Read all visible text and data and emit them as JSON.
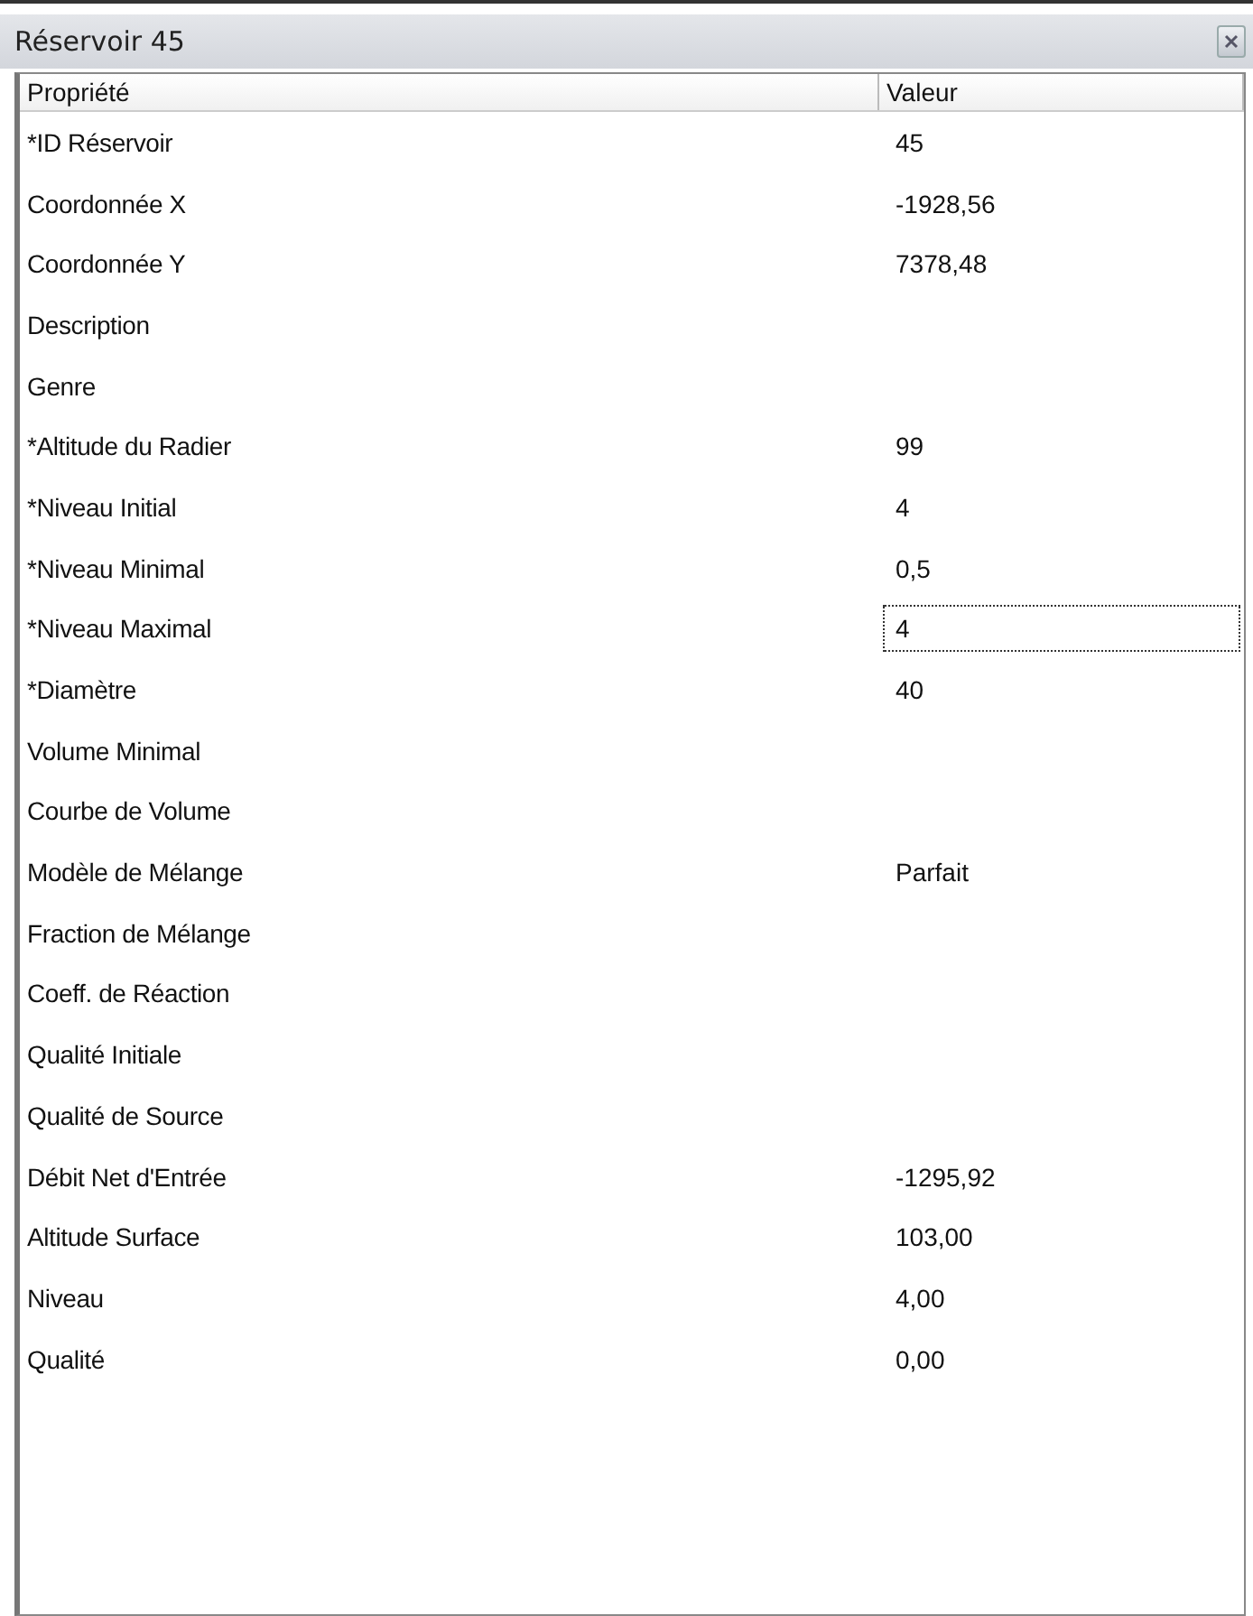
{
  "window": {
    "title": "Réservoir 45"
  },
  "table": {
    "columns": [
      "Propriété",
      "Valeur"
    ],
    "rows": [
      {
        "property": "*ID Réservoir",
        "value": "45",
        "focused": false
      },
      {
        "property": "Coordonnée X",
        "value": "-1928,56",
        "focused": false
      },
      {
        "property": "Coordonnée Y",
        "value": "7378,48",
        "focused": false
      },
      {
        "property": "Description",
        "focused": false
      },
      {
        "property": "Genre",
        "focused": false
      },
      {
        "property": "*Altitude du Radier",
        "value": "99",
        "focused": false
      },
      {
        "property": "*Niveau Initial",
        "value": "4",
        "focused": false
      },
      {
        "property": "*Niveau Minimal",
        "value": "0,5",
        "focused": false
      },
      {
        "property": "*Niveau Maximal",
        "value": "4",
        "focused": true
      },
      {
        "property": "*Diamètre",
        "value": "40",
        "focused": false
      },
      {
        "property": "Volume Minimal",
        "focused": false
      },
      {
        "property": "Courbe de Volume",
        "focused": false
      },
      {
        "property": "Modèle de Mélange",
        "value": "Parfait",
        "focused": false
      },
      {
        "property": "Fraction de Mélange",
        "focused": false
      },
      {
        "property": "Coeff. de Réaction",
        "focused": false
      },
      {
        "property": "Qualité Initiale",
        "focused": false
      },
      {
        "property": "Qualité de Source",
        "focused": false
      },
      {
        "property": "Débit Net d'Entrée",
        "value": "-1295,92",
        "focused": false
      },
      {
        "property": "Altitude Surface",
        "value": "103,00",
        "focused": false
      },
      {
        "property": "Niveau",
        "value": "4,00",
        "focused": false
      },
      {
        "property": "Qualité",
        "value": "0,00",
        "focused": false
      }
    ]
  }
}
